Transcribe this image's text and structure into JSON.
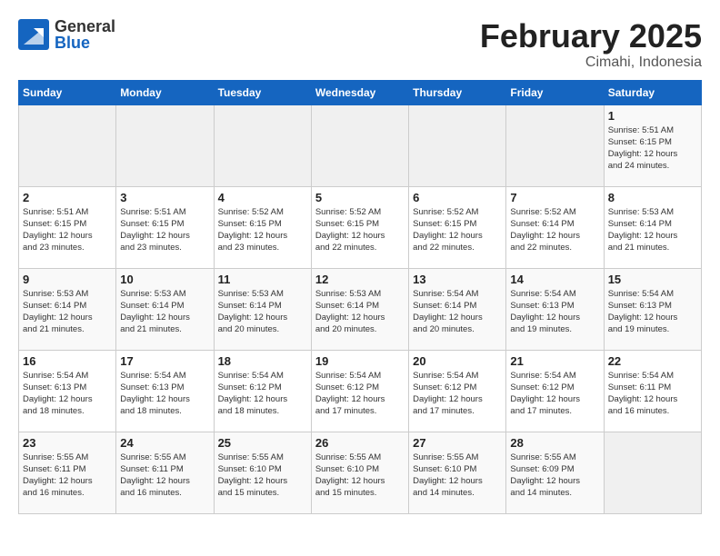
{
  "header": {
    "logo_general": "General",
    "logo_blue": "Blue",
    "month_title": "February 2025",
    "subtitle": "Cimahi, Indonesia"
  },
  "days_of_week": [
    "Sunday",
    "Monday",
    "Tuesday",
    "Wednesday",
    "Thursday",
    "Friday",
    "Saturday"
  ],
  "weeks": [
    [
      {
        "day": "",
        "info": ""
      },
      {
        "day": "",
        "info": ""
      },
      {
        "day": "",
        "info": ""
      },
      {
        "day": "",
        "info": ""
      },
      {
        "day": "",
        "info": ""
      },
      {
        "day": "",
        "info": ""
      },
      {
        "day": "1",
        "info": "Sunrise: 5:51 AM\nSunset: 6:15 PM\nDaylight: 12 hours\nand 24 minutes."
      }
    ],
    [
      {
        "day": "2",
        "info": "Sunrise: 5:51 AM\nSunset: 6:15 PM\nDaylight: 12 hours\nand 23 minutes."
      },
      {
        "day": "3",
        "info": "Sunrise: 5:51 AM\nSunset: 6:15 PM\nDaylight: 12 hours\nand 23 minutes."
      },
      {
        "day": "4",
        "info": "Sunrise: 5:52 AM\nSunset: 6:15 PM\nDaylight: 12 hours\nand 23 minutes."
      },
      {
        "day": "5",
        "info": "Sunrise: 5:52 AM\nSunset: 6:15 PM\nDaylight: 12 hours\nand 22 minutes."
      },
      {
        "day": "6",
        "info": "Sunrise: 5:52 AM\nSunset: 6:15 PM\nDaylight: 12 hours\nand 22 minutes."
      },
      {
        "day": "7",
        "info": "Sunrise: 5:52 AM\nSunset: 6:14 PM\nDaylight: 12 hours\nand 22 minutes."
      },
      {
        "day": "8",
        "info": "Sunrise: 5:53 AM\nSunset: 6:14 PM\nDaylight: 12 hours\nand 21 minutes."
      }
    ],
    [
      {
        "day": "9",
        "info": "Sunrise: 5:53 AM\nSunset: 6:14 PM\nDaylight: 12 hours\nand 21 minutes."
      },
      {
        "day": "10",
        "info": "Sunrise: 5:53 AM\nSunset: 6:14 PM\nDaylight: 12 hours\nand 21 minutes."
      },
      {
        "day": "11",
        "info": "Sunrise: 5:53 AM\nSunset: 6:14 PM\nDaylight: 12 hours\nand 20 minutes."
      },
      {
        "day": "12",
        "info": "Sunrise: 5:53 AM\nSunset: 6:14 PM\nDaylight: 12 hours\nand 20 minutes."
      },
      {
        "day": "13",
        "info": "Sunrise: 5:54 AM\nSunset: 6:14 PM\nDaylight: 12 hours\nand 20 minutes."
      },
      {
        "day": "14",
        "info": "Sunrise: 5:54 AM\nSunset: 6:13 PM\nDaylight: 12 hours\nand 19 minutes."
      },
      {
        "day": "15",
        "info": "Sunrise: 5:54 AM\nSunset: 6:13 PM\nDaylight: 12 hours\nand 19 minutes."
      }
    ],
    [
      {
        "day": "16",
        "info": "Sunrise: 5:54 AM\nSunset: 6:13 PM\nDaylight: 12 hours\nand 18 minutes."
      },
      {
        "day": "17",
        "info": "Sunrise: 5:54 AM\nSunset: 6:13 PM\nDaylight: 12 hours\nand 18 minutes."
      },
      {
        "day": "18",
        "info": "Sunrise: 5:54 AM\nSunset: 6:12 PM\nDaylight: 12 hours\nand 18 minutes."
      },
      {
        "day": "19",
        "info": "Sunrise: 5:54 AM\nSunset: 6:12 PM\nDaylight: 12 hours\nand 17 minutes."
      },
      {
        "day": "20",
        "info": "Sunrise: 5:54 AM\nSunset: 6:12 PM\nDaylight: 12 hours\nand 17 minutes."
      },
      {
        "day": "21",
        "info": "Sunrise: 5:54 AM\nSunset: 6:12 PM\nDaylight: 12 hours\nand 17 minutes."
      },
      {
        "day": "22",
        "info": "Sunrise: 5:54 AM\nSunset: 6:11 PM\nDaylight: 12 hours\nand 16 minutes."
      }
    ],
    [
      {
        "day": "23",
        "info": "Sunrise: 5:55 AM\nSunset: 6:11 PM\nDaylight: 12 hours\nand 16 minutes."
      },
      {
        "day": "24",
        "info": "Sunrise: 5:55 AM\nSunset: 6:11 PM\nDaylight: 12 hours\nand 16 minutes."
      },
      {
        "day": "25",
        "info": "Sunrise: 5:55 AM\nSunset: 6:10 PM\nDaylight: 12 hours\nand 15 minutes."
      },
      {
        "day": "26",
        "info": "Sunrise: 5:55 AM\nSunset: 6:10 PM\nDaylight: 12 hours\nand 15 minutes."
      },
      {
        "day": "27",
        "info": "Sunrise: 5:55 AM\nSunset: 6:10 PM\nDaylight: 12 hours\nand 14 minutes."
      },
      {
        "day": "28",
        "info": "Sunrise: 5:55 AM\nSunset: 6:09 PM\nDaylight: 12 hours\nand 14 minutes."
      },
      {
        "day": "",
        "info": ""
      }
    ]
  ]
}
